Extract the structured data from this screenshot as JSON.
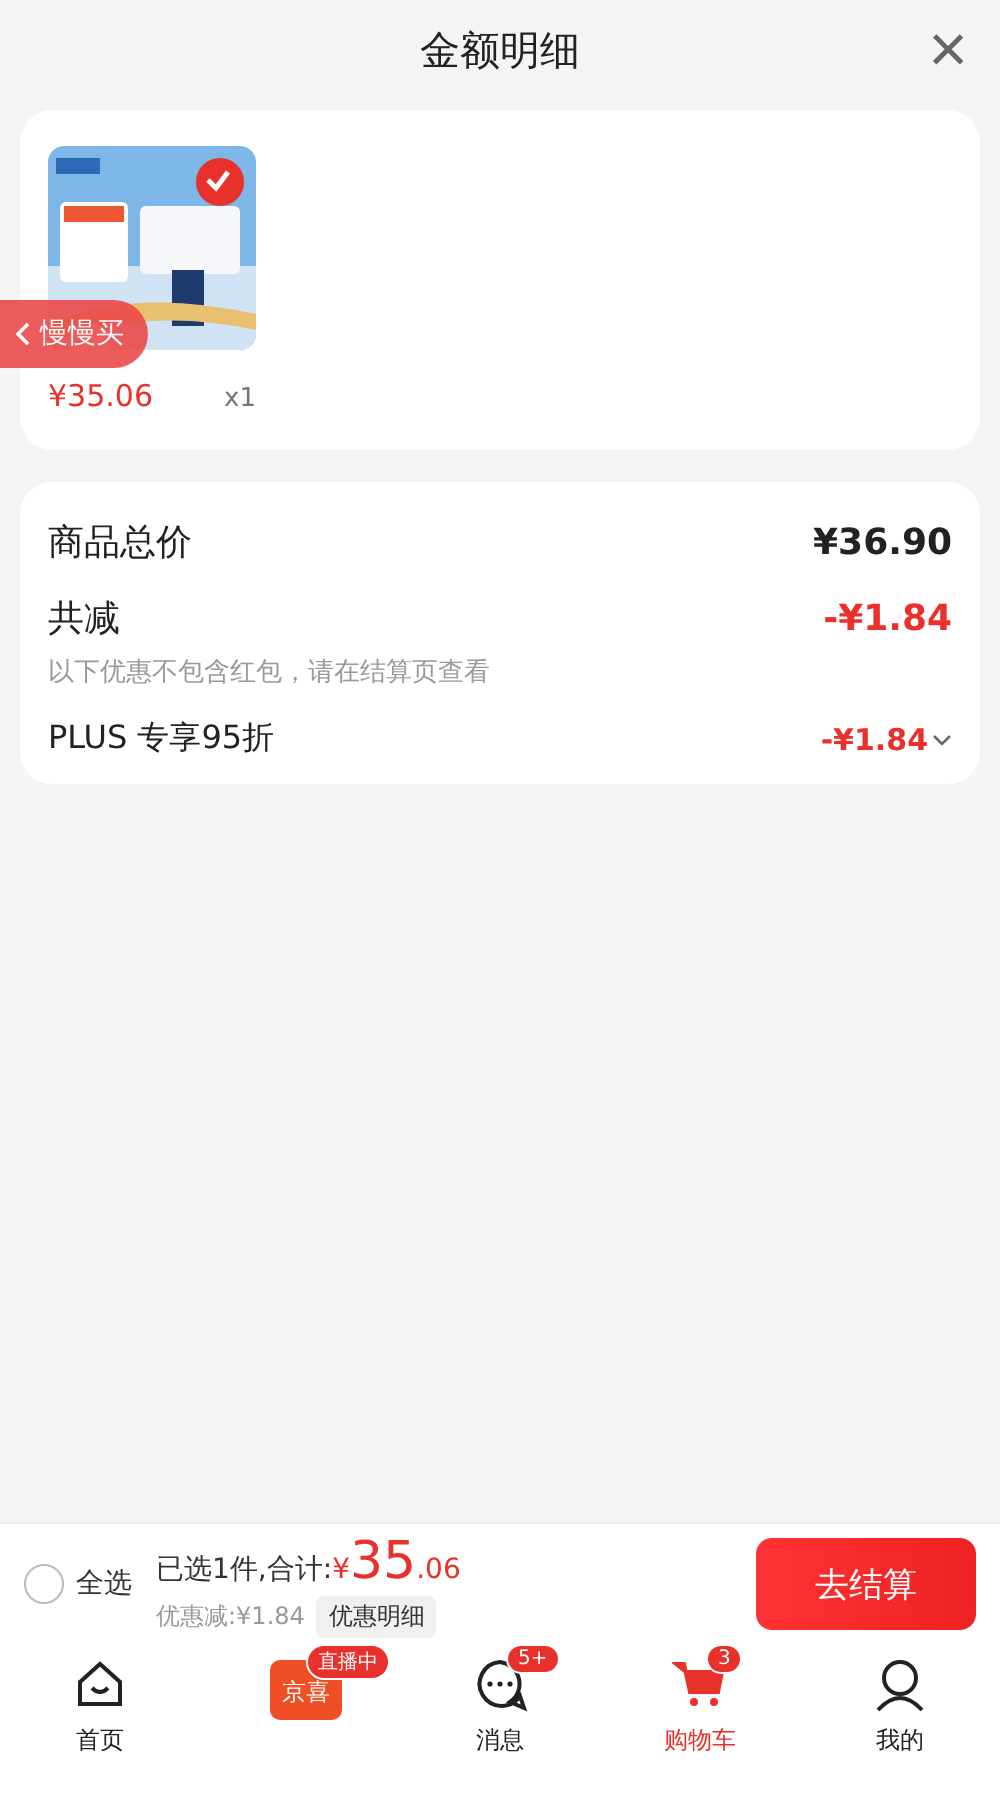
{
  "header": {
    "title": "金额明细",
    "close": "×"
  },
  "products": [
    {
      "kind": "picture",
      "selected": true,
      "price": "¥35.06",
      "quantity": "x1"
    }
  ],
  "float_tab": {
    "label": "慢慢买"
  },
  "summary": {
    "rows": [
      {
        "kind": "total",
        "label": "商品总价",
        "value": "¥36.90"
      },
      {
        "kind": "reduce",
        "label": "共减",
        "value": "-¥1.84",
        "note": "以下优惠不包含红包，请在结算页查看"
      },
      {
        "kind": "discount",
        "label": "PLUS 专享95折",
        "value": "-¥1.84",
        "expanded": false
      }
    ]
  },
  "checkout": {
    "select_all": {
      "label": "全选",
      "checked": false
    },
    "selected_text": "已选1件,合计:",
    "currency": "¥",
    "amount_int": "35",
    "amount_dec": ".06",
    "saving": "优惠减:¥1.84",
    "detail_button": "优惠明细",
    "button": "去结算"
  },
  "tabbar": [
    {
      "kind": "home",
      "label": "首页",
      "selected": false
    },
    {
      "kind": "live",
      "logo": "京喜",
      "badge": "直播中",
      "selected": false
    },
    {
      "kind": "message",
      "label": "消息",
      "badge": "5+",
      "selected": false
    },
    {
      "kind": "cart",
      "label": "购物车",
      "badge": "3",
      "selected": true
    },
    {
      "kind": "me",
      "label": "我的",
      "selected": false
    }
  ]
}
